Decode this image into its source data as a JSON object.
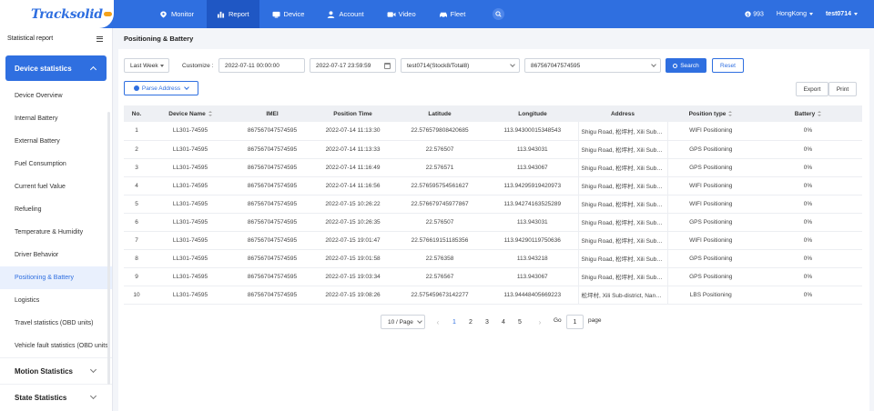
{
  "brand": {
    "logo": "Tracksolid",
    "logo_badge": "pro"
  },
  "nav": [
    {
      "label": "Monitor",
      "icon": "monitor-icon",
      "active": false
    },
    {
      "label": "Report",
      "icon": "bar-chart-icon",
      "active": true
    },
    {
      "label": "Device",
      "icon": "device-icon",
      "active": false
    },
    {
      "label": "Account",
      "icon": "user-icon",
      "active": false
    },
    {
      "label": "Video",
      "icon": "video-icon",
      "active": false
    },
    {
      "label": "Fleet",
      "icon": "car-icon",
      "active": false
    }
  ],
  "header_right": {
    "points": "993",
    "timezone": "HongKong",
    "user": "test0714"
  },
  "sidebar": {
    "title": "Statistical report",
    "group": "Device statistics",
    "items": [
      "Device Overview",
      "Internal Battery",
      "External Battery",
      "Fuel Consumption",
      "Current fuel Value",
      "Refueling",
      "Temperature & Humidity",
      "Driver Behavior",
      "Positioning & Battery",
      "Logistics",
      "Travel statistics (OBD units)",
      "Vehicle fault statistics (OBD units)"
    ],
    "active_index": 8,
    "sections": [
      "Motion Statistics",
      "State Statistics"
    ]
  },
  "page": {
    "title": "Positioning & Battery"
  },
  "filters": {
    "range": "Last Week",
    "customize_label": "Customize :",
    "start": "2022-07-11 00:00:00",
    "end": "2022-07-17 23:59:59",
    "account": "test0714(Stock8/Total8)",
    "imei": "867567047574595",
    "search": "Search",
    "reset": "Reset",
    "parse_address": "Parse Address",
    "export": "Export",
    "print": "Print"
  },
  "table": {
    "columns": [
      "No.",
      "Device Name",
      "IMEI",
      "Position Time",
      "Latitude",
      "Longitude",
      "Address",
      "Position type",
      "Battery"
    ],
    "rows": [
      [
        "1",
        "LL301-74595",
        "867567047574595",
        "2022-07-14 11:13:30",
        "22.576579808420685",
        "113.94300015348543",
        "Shigu Road, 松坪村, Xili Sub-district",
        "WIFI Positioning",
        "0%"
      ],
      [
        "2",
        "LL301-74595",
        "867567047574595",
        "2022-07-14 11:13:33",
        "22.576507",
        "113.943031",
        "Shigu Road, 松坪村, Xili Sub-district",
        "GPS Positioning",
        "0%"
      ],
      [
        "3",
        "LL301-74595",
        "867567047574595",
        "2022-07-14 11:16:49",
        "22.576571",
        "113.943067",
        "Shigu Road, 松坪村, Xili Sub-district",
        "GPS Positioning",
        "0%"
      ],
      [
        "4",
        "LL301-74595",
        "867567047574595",
        "2022-07-14 11:16:56",
        "22.576595754561627",
        "113.94295919420973",
        "Shigu Road, 松坪村, Xili Sub-district",
        "WIFI Positioning",
        "0%"
      ],
      [
        "5",
        "LL301-74595",
        "867567047574595",
        "2022-07-15 10:26:22",
        "22.576679745977867",
        "113.94274163525289",
        "Shigu Road, 松坪村, Xili Sub-district",
        "WIFI Positioning",
        "0%"
      ],
      [
        "6",
        "LL301-74595",
        "867567047574595",
        "2022-07-15 10:26:35",
        "22.576507",
        "113.943031",
        "Shigu Road, 松坪村, Xili Sub-district",
        "GPS Positioning",
        "0%"
      ],
      [
        "7",
        "LL301-74595",
        "867567047574595",
        "2022-07-15 19:01:47",
        "22.576619151185356",
        "113.94290119750636",
        "Shigu Road, 松坪村, Xili Sub-district",
        "WIFI Positioning",
        "0%"
      ],
      [
        "8",
        "LL301-74595",
        "867567047574595",
        "2022-07-15 19:01:58",
        "22.576358",
        "113.943218",
        "Shigu Road, 松坪村, Xili Sub-district",
        "GPS Positioning",
        "0%"
      ],
      [
        "9",
        "LL301-74595",
        "867567047574595",
        "2022-07-15 19:03:34",
        "22.576567",
        "113.943067",
        "Shigu Road, 松坪村, Xili Sub-district",
        "GPS Positioning",
        "0%"
      ],
      [
        "10",
        "LL301-74595",
        "867567047574595",
        "2022-07-15 19:08:26",
        "22.575459673142277",
        "113.94448405669223",
        "松坪村, Xili Sub-district, Nanshan",
        "LBS Positioning",
        "0%"
      ]
    ]
  },
  "pagination": {
    "page_size": "10 / Page",
    "pages": [
      "1",
      "2",
      "3",
      "4",
      "5"
    ],
    "current": "1",
    "go_label": "Go",
    "go_value": "1",
    "page_label": "page"
  },
  "colors": {
    "primary": "#2f6fe0",
    "nav_active": "#1f57c4"
  }
}
